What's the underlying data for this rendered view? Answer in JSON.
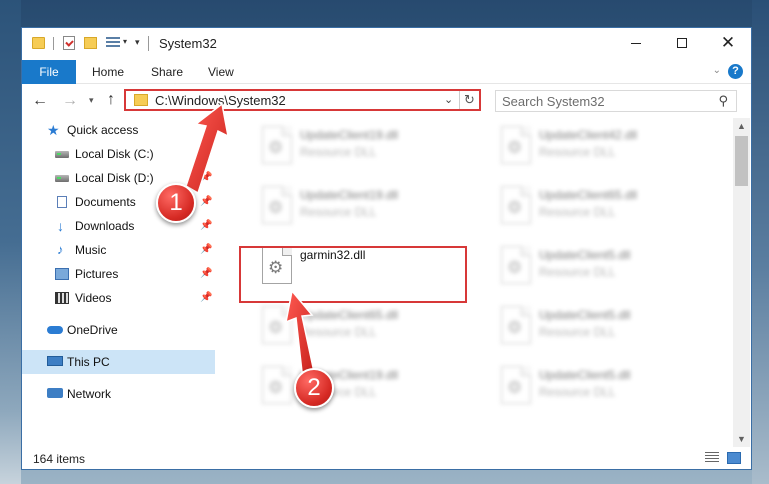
{
  "window": {
    "title": "System32",
    "controls": {
      "minimize": "minimize",
      "maximize": "maximize",
      "close": "✕"
    }
  },
  "ribbon": {
    "file": "File",
    "tabs": [
      "Home",
      "Share",
      "View"
    ],
    "help": "?"
  },
  "navigation": {
    "address": "C:\\Windows\\System32",
    "search_placeholder": "Search System32"
  },
  "sidebar": {
    "items": [
      {
        "label": "Quick access",
        "icon": "star-icon",
        "pinned": false
      },
      {
        "label": "Local Disk (C:)",
        "icon": "drive-icon",
        "pinned": true
      },
      {
        "label": "Local Disk (D:)",
        "icon": "drive-icon",
        "pinned": true
      },
      {
        "label": "Documents",
        "icon": "documents-icon",
        "pinned": true
      },
      {
        "label": "Downloads",
        "icon": "download-icon",
        "pinned": true
      },
      {
        "label": "Music",
        "icon": "music-icon",
        "pinned": true
      },
      {
        "label": "Pictures",
        "icon": "pictures-icon",
        "pinned": true
      },
      {
        "label": "Videos",
        "icon": "videos-icon",
        "pinned": true
      },
      {
        "label": "OneDrive",
        "icon": "onedrive-icon",
        "pinned": false
      },
      {
        "label": "This PC",
        "icon": "computer-icon",
        "pinned": false,
        "selected": true
      },
      {
        "label": "Network",
        "icon": "network-icon",
        "pinned": false
      }
    ]
  },
  "files": [
    {
      "name": "UpdateClient19.dll",
      "type": "Resource DLL",
      "blurred": true
    },
    {
      "name": "UpdateClient42.dll",
      "type": "Resource DLL",
      "blurred": true
    },
    {
      "name": "UpdateClient19.dll",
      "type": "Resource DLL",
      "blurred": true
    },
    {
      "name": "UpdateClient65.dll",
      "type": "Resource DLL",
      "blurred": true
    },
    {
      "name": "garmin32.dll",
      "type": "",
      "blurred": false,
      "highlighted": true
    },
    {
      "name": "UpdateClient5.dll",
      "type": "Resource DLL",
      "blurred": true
    },
    {
      "name": "UpdateClient65.dll",
      "type": "Resource DLL",
      "blurred": true
    },
    {
      "name": "UpdateClient5.dll",
      "type": "Resource DLL",
      "blurred": true
    },
    {
      "name": "UpdateClient19.dll",
      "type": "Resource DLL",
      "blurred": true
    },
    {
      "name": "UpdateClient5.dll",
      "type": "Resource DLL",
      "blurred": true
    }
  ],
  "status": {
    "item_count": "164 items"
  },
  "annotations": {
    "step1": "1",
    "step2": "2",
    "color": "#d73838"
  }
}
